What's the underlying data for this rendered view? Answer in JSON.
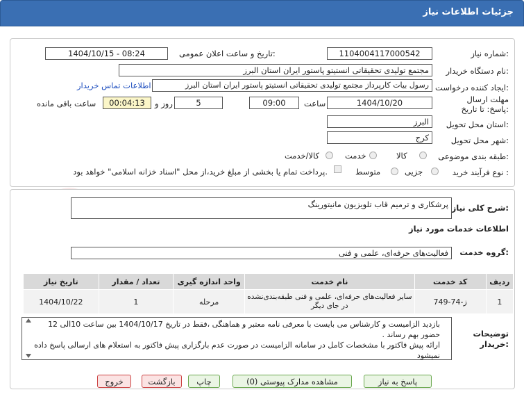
{
  "header": {
    "title": "جزئیات اطلاعات نیاز"
  },
  "fields": {
    "need_number_label": "شماره نیاز:",
    "need_number": "1104004117000542",
    "announce_label": "تاریخ و ساعت اعلان عمومی:",
    "announce_value": "1404/10/15 - 08:24",
    "buyer_label": "نام دستگاه خریدار:",
    "buyer_value": "مجتمع تولیدی تحقیقاتی انستیتو پاستور ایران استان البرز",
    "creator_label": "ایجاد کننده درخواست:",
    "creator_value": "رسول بیات کارپرداز مجتمع تولیدی تحقیقاتی انستیتو پاستور ایران استان البرز",
    "contact_link": "اطلاعات تماس خریدار",
    "deadline_label": "مهلت ارسال پاسخ: تا تاریخ:",
    "deadline_date": "1404/10/20",
    "hour_label": "ساعت",
    "deadline_time": "09:00",
    "days_value": "5",
    "days_label": "روز و",
    "remaining_value": "00:04:13",
    "remaining_label": "ساعت باقی مانده",
    "province_label": "استان محل تحویل:",
    "province_value": "البرز",
    "city_label": "شهر محل تحویل:",
    "city_value": "کرج",
    "category_label": "طبقه بندی موضوعی:",
    "category_options": [
      "کالا",
      "خدمت",
      "کالا/خدمت"
    ],
    "process_label": "نوع فرآیند خرید :",
    "process_options": [
      "جزیی",
      "متوسط"
    ],
    "payment_note": "پرداخت تمام یا بخشی از مبلغ خرید،از محل \"اسناد خزانه اسلامی\" خواهد بود."
  },
  "description": {
    "label": "شرح کلی نیاز:",
    "value": "پرشکاری و ترمیم قاب تلویزیون مانیتورینگ"
  },
  "services": {
    "section_title": "اطلاعات خدمات مورد نیاز",
    "group_label": "گروه خدمت:",
    "group_value": "فعالیت‌های حرفه‌ای، علمی و فنی",
    "columns": [
      "ردیف",
      "کد خدمت",
      "نام خدمت",
      "واحد اندازه گیری",
      "تعداد / مقدار",
      "تاریخ نیاز"
    ],
    "rows": [
      [
        "1",
        "ز-74-749",
        "سایر فعالیت‌های حرفه‌ای، علمی و فنی طبقه‌بندی‌نشده در جای دیگر",
        "مرحله",
        "1",
        "1404/10/22"
      ]
    ]
  },
  "notes": {
    "label": "توضیحات خریدار:",
    "line1": "بازدید الزامیست و کارشناس می بایست با معرفی نامه معتبر و هماهنگی ،فقط در تاریخ 1404/10/17 بین ساعت 10الی 12 حضور بهم رساند .",
    "line2": "ارائه پیش فاکتور با مشخصات کامل در سامانه الزامیست در صورت عدم بارگزاری پیش فاکتور به استعلام های ارسالی پاسخ داده نمیشود"
  },
  "buttons": {
    "reply": "پاسخ به نیاز",
    "attachments": "مشاهده مدارک پیوستی (0)",
    "print": "چاپ",
    "back": "بازگشت",
    "exit": "خروج"
  },
  "colors": {
    "header": "#3a6fb3",
    "remaining_bg": "#fbf6c8",
    "link": "#1f4fbf"
  }
}
